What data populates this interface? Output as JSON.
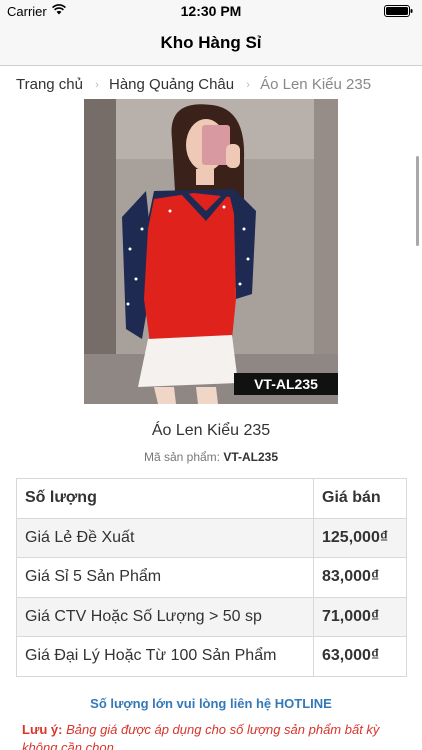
{
  "status_bar": {
    "carrier": "Carrier",
    "time": "12:30 PM"
  },
  "nav": {
    "title": "Kho Hàng Sỉ"
  },
  "breadcrumb": {
    "items": [
      "Trang chủ",
      "Hàng Quảng Châu"
    ],
    "current": "Áo Len Kiểu 235"
  },
  "product": {
    "name": "Áo Len Kiểu 235",
    "code_label": "Mã sản phẩm:",
    "code": "VT-AL235",
    "image_tag": "VT-AL235"
  },
  "price_table": {
    "headers": [
      "Số lượng",
      "Giá bán"
    ],
    "rows": [
      {
        "label": "Giá Lẻ Đề Xuất",
        "price": "125,000₫"
      },
      {
        "label": "Giá Sỉ 5 Sản Phẩm",
        "price": "83,000₫"
      },
      {
        "label": "Giá CTV Hoặc Số Lượng > 50 sp",
        "price": "71,000₫"
      },
      {
        "label": "Giá Đại Lý Hoặc Từ 100 Sản Phẩm",
        "price": "63,000₫"
      }
    ]
  },
  "hotline": "Số lượng lớn vui lòng liên hệ HOTLINE",
  "note": {
    "label": "Lưu ý:",
    "text": "Bảng giá được áp dụng cho số lượng sản phẩm bất kỳ không cần chọn"
  },
  "colors": {
    "accent": "#3479b7",
    "note": "#d9342b",
    "sweater": "#e0221d"
  }
}
